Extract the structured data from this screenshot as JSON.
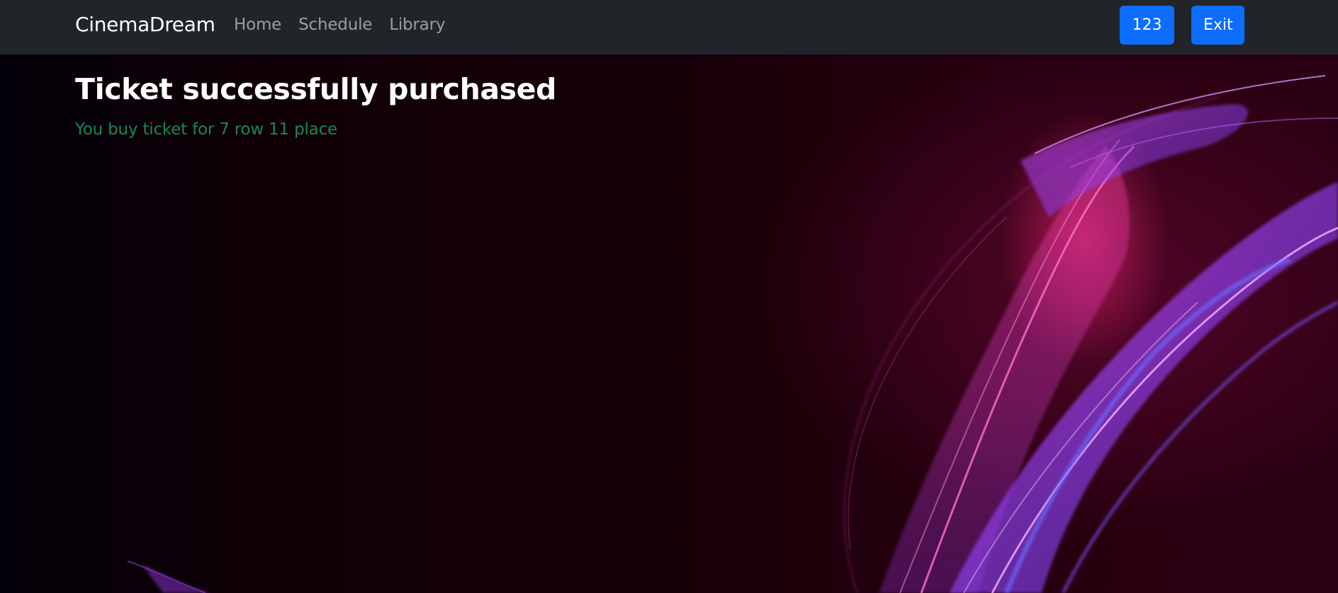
{
  "navbar": {
    "brand": "CinemaDream",
    "links": [
      "Home",
      "Schedule",
      "Library"
    ],
    "account_label": "123",
    "exit_label": "Exit",
    "background_color": "#212529",
    "button_color": "#0d6efd"
  },
  "main": {
    "title": "Ticket successfully purchased",
    "message": "You buy ticket for 7 row 11 place",
    "message_color": "#198754"
  },
  "background": {
    "description_icon": "abstract-purple-pink-waves"
  }
}
